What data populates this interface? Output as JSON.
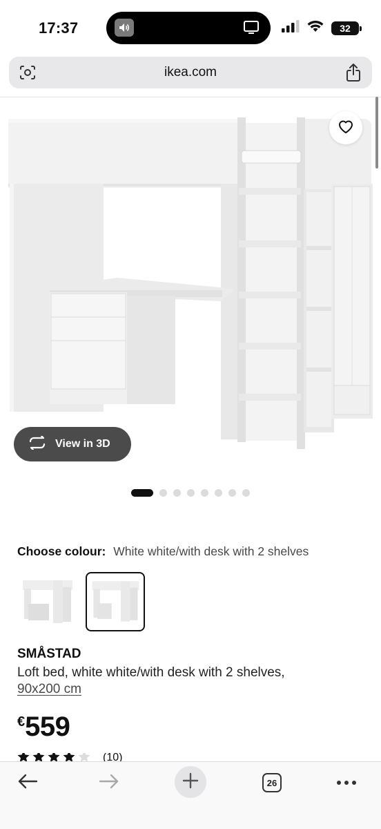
{
  "status_bar": {
    "time": "17:37",
    "battery": "32",
    "icons": [
      "speaker-icon",
      "screen-mirror-icon",
      "signal-icon",
      "wifi-icon",
      "battery-icon"
    ]
  },
  "browser": {
    "url": "ikea.com",
    "tab_count": "26"
  },
  "product_image": {
    "view_3d_label": "View in 3D",
    "carousel_total": 8,
    "carousel_active": 1
  },
  "colour": {
    "label": "Choose colour:",
    "value": "White white/with desk with 2 shelves"
  },
  "product": {
    "name": "SMÅSTAD",
    "description": "Loft bed, white white/with desk with 2 shelves,",
    "size": "90x200 cm",
    "price_currency": "€",
    "price_amount": "559",
    "rating_count": "(10)",
    "rating_stars": 4
  },
  "colors": {
    "dark_button": "#4b4b4b",
    "active_dot": "#111111",
    "inactive_dot": "#dcdcdc"
  }
}
